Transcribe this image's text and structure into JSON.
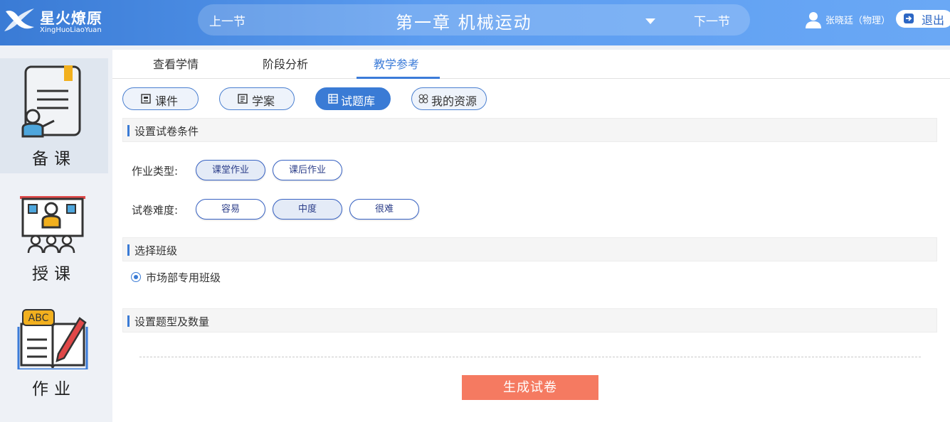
{
  "header": {
    "logo_title": "星火燎原",
    "logo_subtitle": "XingHuoLiaoYuan",
    "prev_label": "上一节",
    "next_label": "下一节",
    "chapter_title": "第一章  机械运动",
    "user_name": "张晓廷（物理）",
    "logout_label": "退出"
  },
  "sidebar": {
    "items": [
      {
        "label": "备课",
        "icon": "lesson-prep-icon",
        "active": true
      },
      {
        "label": "授课",
        "icon": "teaching-icon",
        "active": false
      },
      {
        "label": "作业",
        "icon": "homework-icon",
        "active": false
      }
    ]
  },
  "tabs": [
    {
      "label": "查看学情",
      "active": false
    },
    {
      "label": "阶段分析",
      "active": false
    },
    {
      "label": "教学参考",
      "active": true
    }
  ],
  "resource_pills": [
    {
      "label": "课件",
      "icon": "courseware-icon",
      "active": false
    },
    {
      "label": "学案",
      "icon": "study-plan-icon",
      "active": false
    },
    {
      "label": "试题库",
      "icon": "question-bank-icon",
      "active": true
    },
    {
      "label": "我的资源",
      "icon": "my-resources-icon",
      "active": false
    }
  ],
  "conditions": {
    "section_title": "设置试卷条件",
    "homework_type_label": "作业类型:",
    "homework_types": [
      {
        "label": "课堂作业",
        "selected": true
      },
      {
        "label": "课后作业",
        "selected": false
      }
    ],
    "difficulty_label": "试卷难度:",
    "difficulties": [
      {
        "label": "容易",
        "selected": false
      },
      {
        "label": "中度",
        "selected": true
      },
      {
        "label": "很难",
        "selected": false
      }
    ]
  },
  "class_section": {
    "section_title": "选择班级",
    "classes": [
      {
        "label": "市场部专用班级",
        "checked": true
      }
    ]
  },
  "question_section": {
    "section_title": "设置题型及数量"
  },
  "generate_button": "生成试卷",
  "colors": {
    "primary": "#3a7bd5",
    "generate": "#f57a61",
    "sidebar_bg": "#eef1f6",
    "sidebar_active": "#dfe6ef"
  }
}
